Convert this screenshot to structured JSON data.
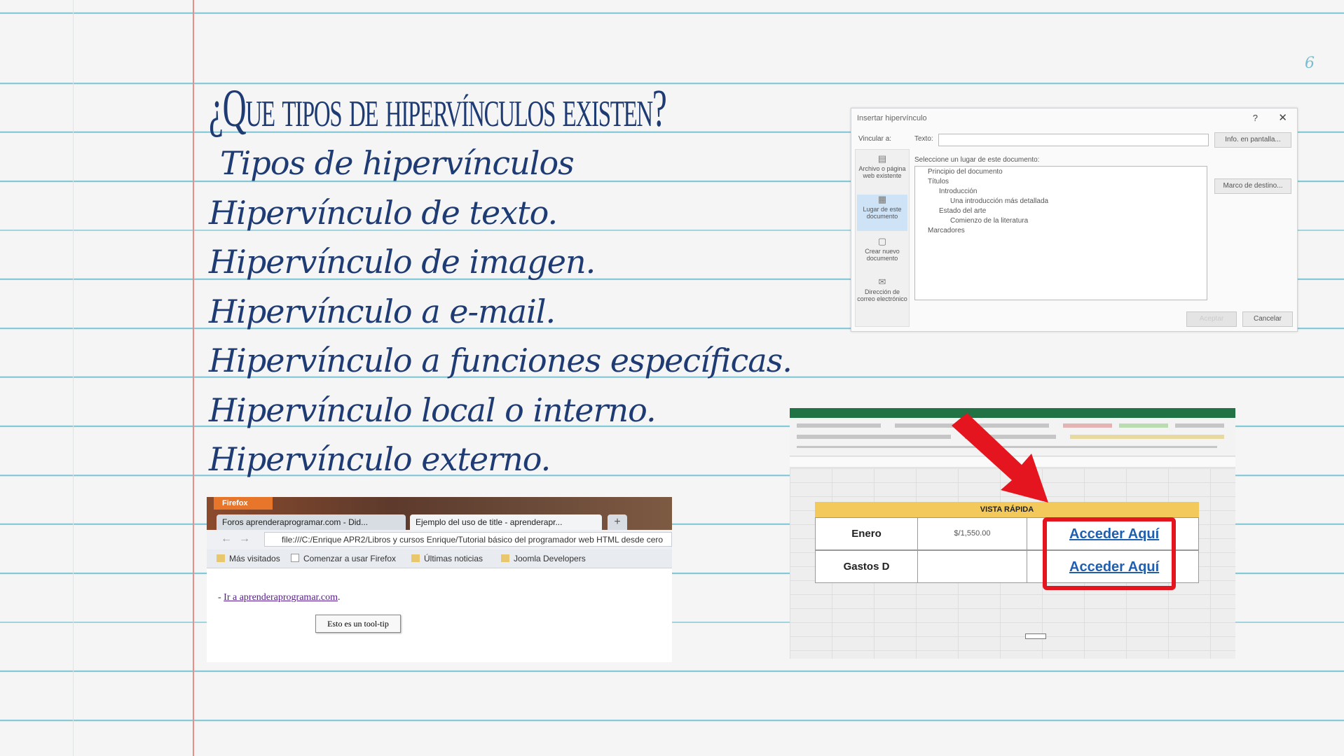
{
  "page_number": "6",
  "title": "¿Que tipos de hipervínculos existen?",
  "bullets": [
    "Tipos de hipervínculos",
    "Hipervínculo de texto.",
    "Hipervínculo de imagen.",
    "Hipervínculo a e-mail.",
    "Hipervínculo a funciones específicas.",
    "Hipervínculo local o interno.",
    "Hipervínculo externo."
  ],
  "dialog": {
    "title": "Insertar hipervínculo",
    "help": "?",
    "close": "✕",
    "vincular_label": "Vincular a:",
    "texto_label": "Texto:",
    "screen_tip_button": "Info. en pantalla...",
    "select_place_label": "Seleccione un lugar de este documento:",
    "bookmark_button": "Marco de destino...",
    "ok_button": "Aceptar",
    "cancel_button": "Cancelar",
    "side_items": [
      "Archivo o página web existente",
      "Lugar de este documento",
      "Crear nuevo documento",
      "Dirección de correo electrónico"
    ],
    "tree": [
      "Principio del documento",
      "Títulos",
      "Introducción",
      "Una introducción más detallada",
      "Estado del arte",
      "Comienzo de la literatura",
      "Marcadores"
    ]
  },
  "browser": {
    "app_button": "Firefox",
    "tabs": [
      "Foros aprenderaprogramar.com - Did...",
      "Ejemplo del uso de title - aprenderapr..."
    ],
    "tab_add": "+",
    "url": "file:///C:/Enrique APR2/Libros y cursos Enrique/Tutorial básico del programador web HTML desde cero",
    "bookmarks": [
      "Más visitados",
      "Comenzar a usar Firefox",
      "Últimas noticias",
      "Joomla Developers"
    ],
    "link_prefix": "- ",
    "link_text": "Ir a aprenderaprogramar.com",
    "link_suffix": ".",
    "tooltip_button": "Esto es un tool-tip"
  },
  "excel": {
    "header": "VISTA RÁPIDA",
    "rows": [
      {
        "label": "Enero",
        "value": "$/1,550.00",
        "link": "Acceder Aquí"
      },
      {
        "label": "Gastos D",
        "value": "",
        "link": "Acceder Aquí"
      }
    ],
    "colors": {
      "title_bar": "#217346",
      "header_fill": "#f2c95a",
      "highlight": "#e4151f",
      "link": "#1f5fb0"
    }
  }
}
